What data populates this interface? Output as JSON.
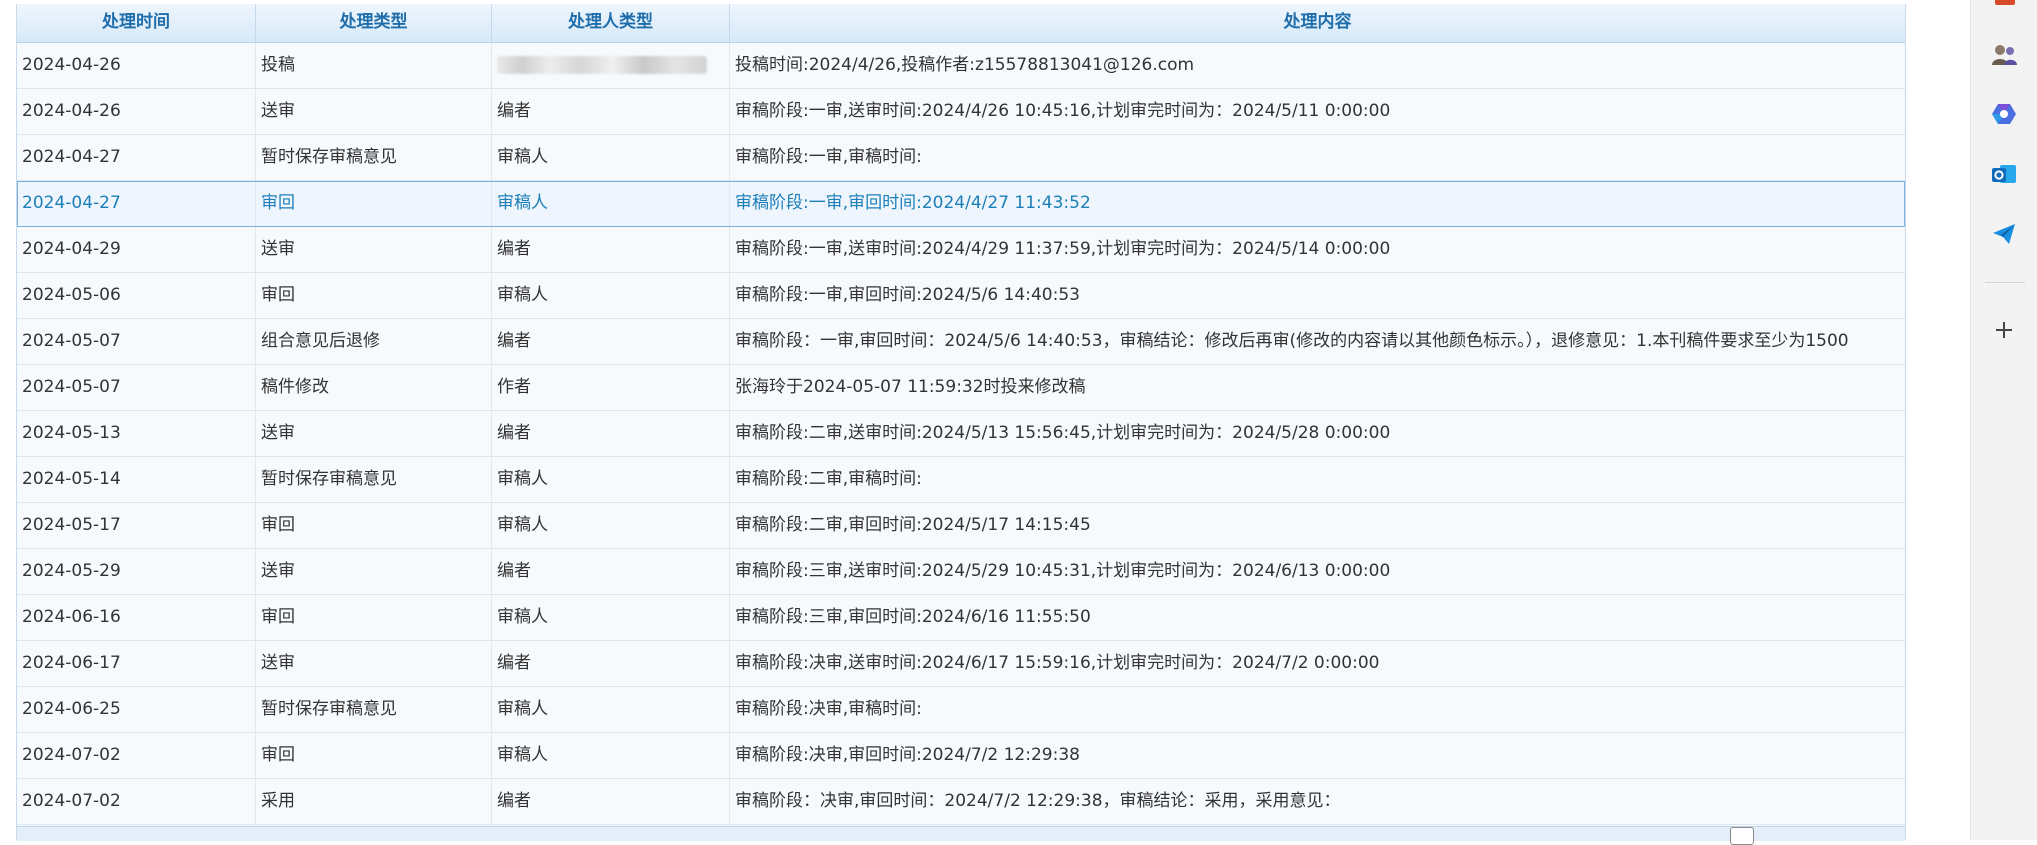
{
  "table": {
    "headers": [
      "处理时间",
      "处理类型",
      "处理人类型",
      "处理内容"
    ],
    "rows": [
      {
        "time": "2024-04-26",
        "type": "投稿",
        "role": "",
        "content": "投稿时间:2024/4/26,投稿作者:z15578813041@126.com",
        "redacted_role": true
      },
      {
        "time": "2024-04-26",
        "type": "送审",
        "role": "编者",
        "content": "审稿阶段:一审,送审时间:2024/4/26 10:45:16,计划审完时间为：2024/5/11 0:00:00"
      },
      {
        "time": "2024-04-27",
        "type": "暂时保存审稿意见",
        "role": "审稿人",
        "content": "审稿阶段:一审,审稿时间:"
      },
      {
        "time": "2024-04-27",
        "type": "审回",
        "role": "审稿人",
        "content": "审稿阶段:一审,审回时间:2024/4/27 11:43:52",
        "selected": true
      },
      {
        "time": "2024-04-29",
        "type": "送审",
        "role": "编者",
        "content": "审稿阶段:一审,送审时间:2024/4/29 11:37:59,计划审完时间为：2024/5/14 0:00:00"
      },
      {
        "time": "2024-05-06",
        "type": "审回",
        "role": "审稿人",
        "content": "审稿阶段:一审,审回时间:2024/5/6 14:40:53"
      },
      {
        "time": "2024-05-07",
        "type": "组合意见后退修",
        "role": "编者",
        "content": "审稿阶段：一审,审回时间：2024/5/6 14:40:53，审稿结论：修改后再审(修改的内容请以其他颜色标示。），退修意见：1.本刊稿件要求至少为1500"
      },
      {
        "time": "2024-05-07",
        "type": "稿件修改",
        "role": "作者",
        "content": "张海玲于2024-05-07 11:59:32时投来修改稿"
      },
      {
        "time": "2024-05-13",
        "type": "送审",
        "role": "编者",
        "content": "审稿阶段:二审,送审时间:2024/5/13 15:56:45,计划审完时间为：2024/5/28 0:00:00"
      },
      {
        "time": "2024-05-14",
        "type": "暂时保存审稿意见",
        "role": "审稿人",
        "content": "审稿阶段:二审,审稿时间:"
      },
      {
        "time": "2024-05-17",
        "type": "审回",
        "role": "审稿人",
        "content": "审稿阶段:二审,审回时间:2024/5/17 14:15:45"
      },
      {
        "time": "2024-05-29",
        "type": "送审",
        "role": "编者",
        "content": "审稿阶段:三审,送审时间:2024/5/29 10:45:31,计划审完时间为：2024/6/13 0:00:00"
      },
      {
        "time": "2024-06-16",
        "type": "审回",
        "role": "审稿人",
        "content": "审稿阶段:三审,审回时间:2024/6/16 11:55:50"
      },
      {
        "time": "2024-06-17",
        "type": "送审",
        "role": "编者",
        "content": "审稿阶段:决审,送审时间:2024/6/17 15:59:16,计划审完时间为：2024/7/2 0:00:00"
      },
      {
        "time": "2024-06-25",
        "type": "暂时保存审稿意见",
        "role": "审稿人",
        "content": "审稿阶段:决审,审稿时间:"
      },
      {
        "time": "2024-07-02",
        "type": "审回",
        "role": "审稿人",
        "content": "审稿阶段:决审,审回时间:2024/7/2 12:29:38"
      },
      {
        "time": "2024-07-02",
        "type": "采用",
        "role": "编者",
        "content": "审稿阶段：决审,审回时间：2024/7/2 12:29:38，审稿结论：采用，采用意见："
      }
    ]
  },
  "sidebar": {
    "icons": [
      "user-group-icon",
      "copilot-icon",
      "outlook-icon",
      "send-icon",
      "add-icon"
    ]
  },
  "colors": {
    "header_text": "#1f6eab",
    "selected_text": "#1c7fb8",
    "outlook_blue": "#0f6cbd"
  }
}
